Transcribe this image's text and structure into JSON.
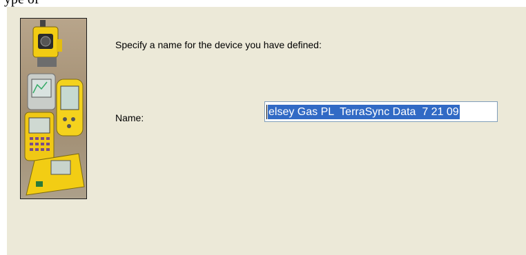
{
  "window": {
    "title_fragment": "... ...ype ... ... ... ... ..."
  },
  "dialog": {
    "prompt": "Specify a name for the device you have defined:",
    "name_label": "Name:",
    "name_value": "elsey Gas PL  TerraSync Data  7 21 09"
  },
  "colors": {
    "dialog_background": "#ece9d8",
    "selection_highlight": "#316ac5",
    "input_border": "#7f9db9"
  },
  "icons": {
    "wizard_image": "survey-devices-illustration"
  }
}
